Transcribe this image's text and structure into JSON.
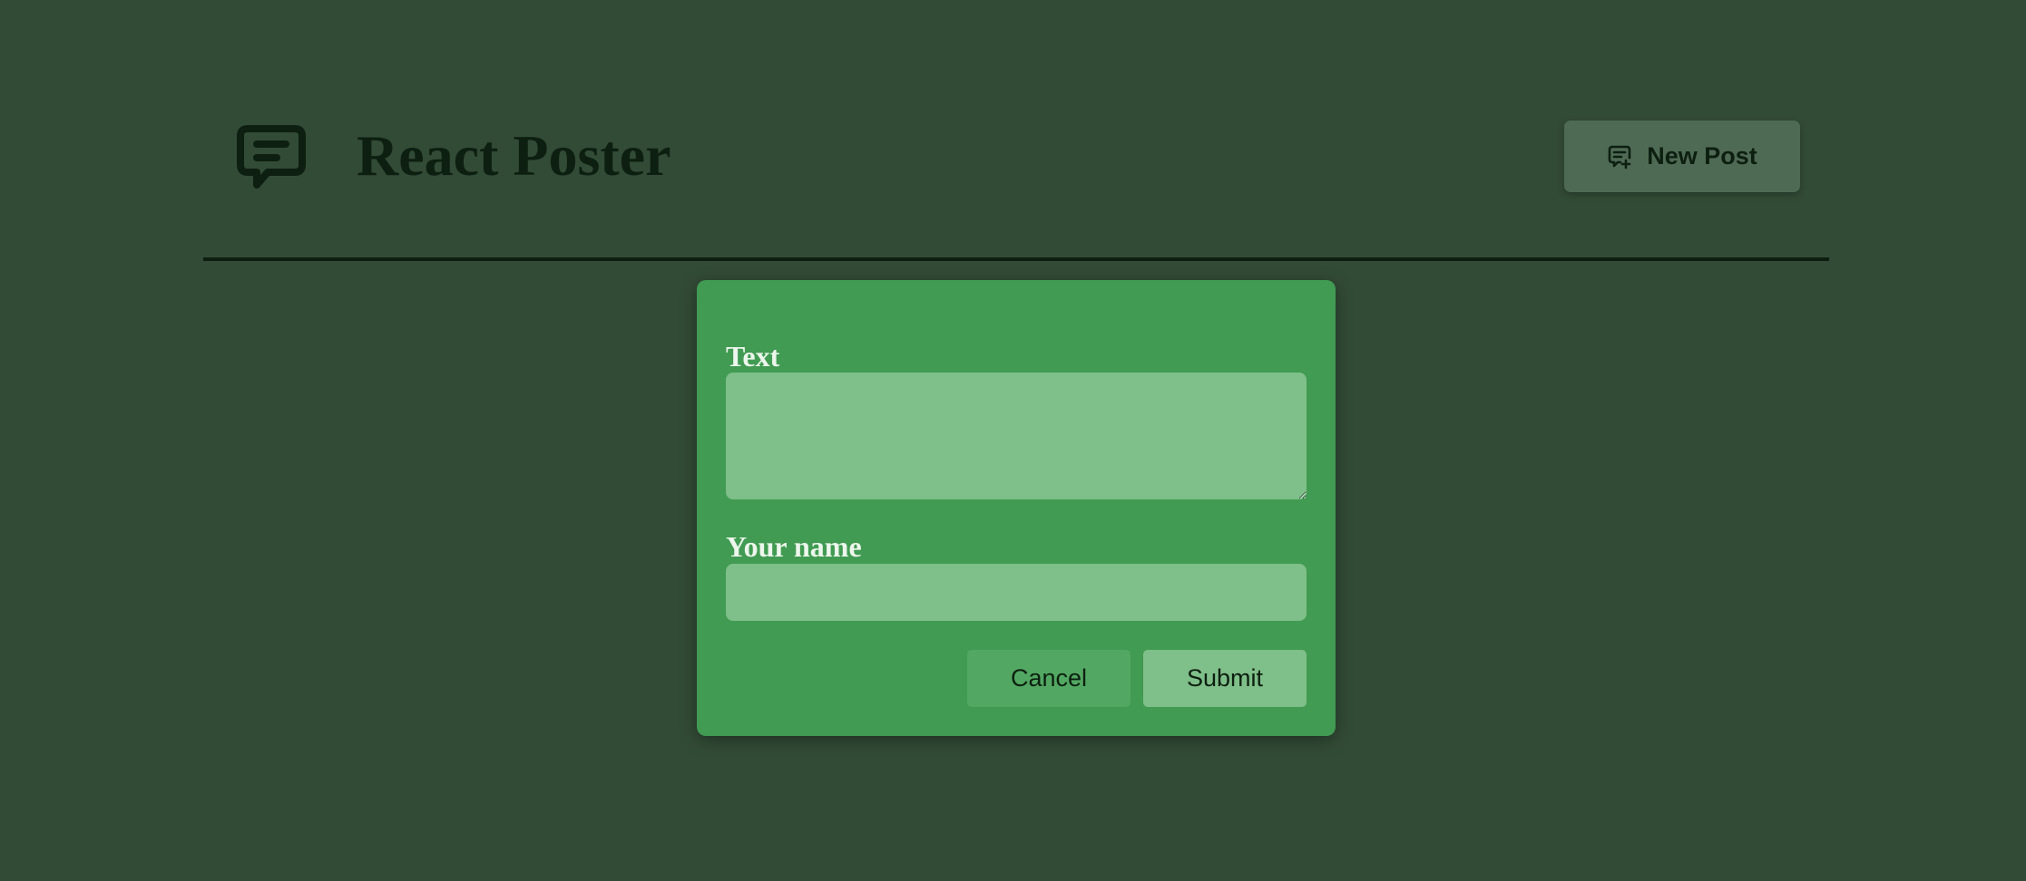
{
  "header": {
    "logo_icon": "chat-bubble-icon",
    "title": "React Poster",
    "new_post_button": {
      "label": "New Post",
      "icon": "message-plus-icon"
    }
  },
  "modal": {
    "text_field": {
      "label": "Text",
      "value": ""
    },
    "name_field": {
      "label": "Your name",
      "value": ""
    },
    "cancel_label": "Cancel",
    "submit_label": "Submit"
  },
  "colors": {
    "background": "#324b36",
    "header_text": "#0d1f10",
    "modal_background": "#419b52",
    "input_background": "#7fbf89",
    "new_post_button_background": "#4f6a54"
  }
}
